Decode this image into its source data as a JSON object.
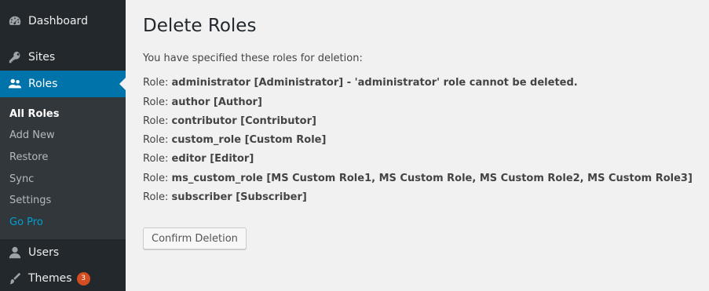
{
  "sidebar": {
    "items": [
      {
        "label": "Dashboard",
        "icon": "dashboard-icon"
      },
      {
        "label": "Sites",
        "icon": "key-icon"
      },
      {
        "label": "Roles",
        "icon": "users-icon"
      },
      {
        "label": "Users",
        "icon": "user-icon"
      },
      {
        "label": "Themes",
        "icon": "brush-icon",
        "badge": "3"
      }
    ],
    "submenu": [
      {
        "label": "All Roles"
      },
      {
        "label": "Add New"
      },
      {
        "label": "Restore"
      },
      {
        "label": "Sync"
      },
      {
        "label": "Settings"
      },
      {
        "label": "Go Pro"
      }
    ]
  },
  "main": {
    "title": "Delete Roles",
    "intro": "You have specified these roles for deletion:",
    "role_prefix": "Role:",
    "roles": [
      {
        "name": "administrator [Administrator] - 'administrator' role cannot be deleted."
      },
      {
        "name": "author [Author]"
      },
      {
        "name": "contributor [Contributor]"
      },
      {
        "name": "custom_role [Custom Role]"
      },
      {
        "name": "editor [Editor]"
      },
      {
        "name": "ms_custom_role [MS Custom Role1, MS Custom Role, MS Custom Role2, MS Custom Role3]"
      },
      {
        "name": "subscriber [Subscriber]"
      }
    ],
    "confirm_label": "Confirm Deletion"
  },
  "colors": {
    "sidebar_bg": "#23282d",
    "submenu_bg": "#32373c",
    "active_bg": "#0073aa",
    "gopro": "#00a0d2",
    "badge": "#d54e21"
  }
}
